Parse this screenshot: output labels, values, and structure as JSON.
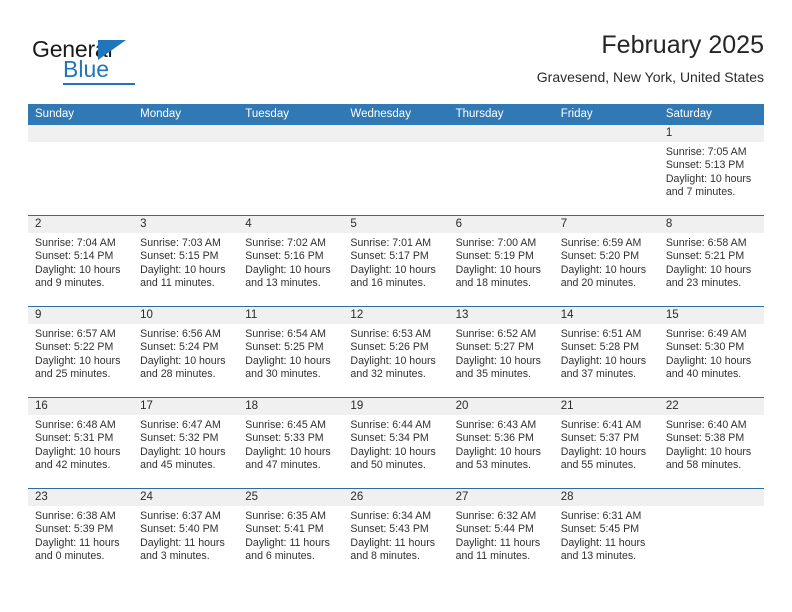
{
  "logo": {
    "word_one": "General",
    "word_two": "Blue",
    "triangle_color": "#2175ba"
  },
  "header": {
    "title": "February 2025",
    "location": "Gravesend, New York, United States",
    "header_bg": "#3179b5",
    "rule_color": "#2e6da4",
    "date_band_bg": "#f0f0f0"
  },
  "weekdays": [
    "Sunday",
    "Monday",
    "Tuesday",
    "Wednesday",
    "Thursday",
    "Friday",
    "Saturday"
  ],
  "labels": {
    "sunrise": "Sunrise:",
    "sunset": "Sunset:",
    "daylight": "Daylight:"
  },
  "weeks": [
    [
      {
        "day": "",
        "sunrise": "",
        "sunset": "",
        "daylight_a": "",
        "daylight_b": ""
      },
      {
        "day": "",
        "sunrise": "",
        "sunset": "",
        "daylight_a": "",
        "daylight_b": ""
      },
      {
        "day": "",
        "sunrise": "",
        "sunset": "",
        "daylight_a": "",
        "daylight_b": ""
      },
      {
        "day": "",
        "sunrise": "",
        "sunset": "",
        "daylight_a": "",
        "daylight_b": ""
      },
      {
        "day": "",
        "sunrise": "",
        "sunset": "",
        "daylight_a": "",
        "daylight_b": ""
      },
      {
        "day": "",
        "sunrise": "",
        "sunset": "",
        "daylight_a": "",
        "daylight_b": ""
      },
      {
        "day": "1",
        "sunrise": "Sunrise: 7:05 AM",
        "sunset": "Sunset: 5:13 PM",
        "daylight_a": "Daylight: 10 hours",
        "daylight_b": "and 7 minutes."
      }
    ],
    [
      {
        "day": "2",
        "sunrise": "Sunrise: 7:04 AM",
        "sunset": "Sunset: 5:14 PM",
        "daylight_a": "Daylight: 10 hours",
        "daylight_b": "and 9 minutes."
      },
      {
        "day": "3",
        "sunrise": "Sunrise: 7:03 AM",
        "sunset": "Sunset: 5:15 PM",
        "daylight_a": "Daylight: 10 hours",
        "daylight_b": "and 11 minutes."
      },
      {
        "day": "4",
        "sunrise": "Sunrise: 7:02 AM",
        "sunset": "Sunset: 5:16 PM",
        "daylight_a": "Daylight: 10 hours",
        "daylight_b": "and 13 minutes."
      },
      {
        "day": "5",
        "sunrise": "Sunrise: 7:01 AM",
        "sunset": "Sunset: 5:17 PM",
        "daylight_a": "Daylight: 10 hours",
        "daylight_b": "and 16 minutes."
      },
      {
        "day": "6",
        "sunrise": "Sunrise: 7:00 AM",
        "sunset": "Sunset: 5:19 PM",
        "daylight_a": "Daylight: 10 hours",
        "daylight_b": "and 18 minutes."
      },
      {
        "day": "7",
        "sunrise": "Sunrise: 6:59 AM",
        "sunset": "Sunset: 5:20 PM",
        "daylight_a": "Daylight: 10 hours",
        "daylight_b": "and 20 minutes."
      },
      {
        "day": "8",
        "sunrise": "Sunrise: 6:58 AM",
        "sunset": "Sunset: 5:21 PM",
        "daylight_a": "Daylight: 10 hours",
        "daylight_b": "and 23 minutes."
      }
    ],
    [
      {
        "day": "9",
        "sunrise": "Sunrise: 6:57 AM",
        "sunset": "Sunset: 5:22 PM",
        "daylight_a": "Daylight: 10 hours",
        "daylight_b": "and 25 minutes."
      },
      {
        "day": "10",
        "sunrise": "Sunrise: 6:56 AM",
        "sunset": "Sunset: 5:24 PM",
        "daylight_a": "Daylight: 10 hours",
        "daylight_b": "and 28 minutes."
      },
      {
        "day": "11",
        "sunrise": "Sunrise: 6:54 AM",
        "sunset": "Sunset: 5:25 PM",
        "daylight_a": "Daylight: 10 hours",
        "daylight_b": "and 30 minutes."
      },
      {
        "day": "12",
        "sunrise": "Sunrise: 6:53 AM",
        "sunset": "Sunset: 5:26 PM",
        "daylight_a": "Daylight: 10 hours",
        "daylight_b": "and 32 minutes."
      },
      {
        "day": "13",
        "sunrise": "Sunrise: 6:52 AM",
        "sunset": "Sunset: 5:27 PM",
        "daylight_a": "Daylight: 10 hours",
        "daylight_b": "and 35 minutes."
      },
      {
        "day": "14",
        "sunrise": "Sunrise: 6:51 AM",
        "sunset": "Sunset: 5:28 PM",
        "daylight_a": "Daylight: 10 hours",
        "daylight_b": "and 37 minutes."
      },
      {
        "day": "15",
        "sunrise": "Sunrise: 6:49 AM",
        "sunset": "Sunset: 5:30 PM",
        "daylight_a": "Daylight: 10 hours",
        "daylight_b": "and 40 minutes."
      }
    ],
    [
      {
        "day": "16",
        "sunrise": "Sunrise: 6:48 AM",
        "sunset": "Sunset: 5:31 PM",
        "daylight_a": "Daylight: 10 hours",
        "daylight_b": "and 42 minutes."
      },
      {
        "day": "17",
        "sunrise": "Sunrise: 6:47 AM",
        "sunset": "Sunset: 5:32 PM",
        "daylight_a": "Daylight: 10 hours",
        "daylight_b": "and 45 minutes."
      },
      {
        "day": "18",
        "sunrise": "Sunrise: 6:45 AM",
        "sunset": "Sunset: 5:33 PM",
        "daylight_a": "Daylight: 10 hours",
        "daylight_b": "and 47 minutes."
      },
      {
        "day": "19",
        "sunrise": "Sunrise: 6:44 AM",
        "sunset": "Sunset: 5:34 PM",
        "daylight_a": "Daylight: 10 hours",
        "daylight_b": "and 50 minutes."
      },
      {
        "day": "20",
        "sunrise": "Sunrise: 6:43 AM",
        "sunset": "Sunset: 5:36 PM",
        "daylight_a": "Daylight: 10 hours",
        "daylight_b": "and 53 minutes."
      },
      {
        "day": "21",
        "sunrise": "Sunrise: 6:41 AM",
        "sunset": "Sunset: 5:37 PM",
        "daylight_a": "Daylight: 10 hours",
        "daylight_b": "and 55 minutes."
      },
      {
        "day": "22",
        "sunrise": "Sunrise: 6:40 AM",
        "sunset": "Sunset: 5:38 PM",
        "daylight_a": "Daylight: 10 hours",
        "daylight_b": "and 58 minutes."
      }
    ],
    [
      {
        "day": "23",
        "sunrise": "Sunrise: 6:38 AM",
        "sunset": "Sunset: 5:39 PM",
        "daylight_a": "Daylight: 11 hours",
        "daylight_b": "and 0 minutes."
      },
      {
        "day": "24",
        "sunrise": "Sunrise: 6:37 AM",
        "sunset": "Sunset: 5:40 PM",
        "daylight_a": "Daylight: 11 hours",
        "daylight_b": "and 3 minutes."
      },
      {
        "day": "25",
        "sunrise": "Sunrise: 6:35 AM",
        "sunset": "Sunset: 5:41 PM",
        "daylight_a": "Daylight: 11 hours",
        "daylight_b": "and 6 minutes."
      },
      {
        "day": "26",
        "sunrise": "Sunrise: 6:34 AM",
        "sunset": "Sunset: 5:43 PM",
        "daylight_a": "Daylight: 11 hours",
        "daylight_b": "and 8 minutes."
      },
      {
        "day": "27",
        "sunrise": "Sunrise: 6:32 AM",
        "sunset": "Sunset: 5:44 PM",
        "daylight_a": "Daylight: 11 hours",
        "daylight_b": "and 11 minutes."
      },
      {
        "day": "28",
        "sunrise": "Sunrise: 6:31 AM",
        "sunset": "Sunset: 5:45 PM",
        "daylight_a": "Daylight: 11 hours",
        "daylight_b": "and 13 minutes."
      },
      {
        "day": "",
        "sunrise": "",
        "sunset": "",
        "daylight_a": "",
        "daylight_b": ""
      }
    ]
  ]
}
